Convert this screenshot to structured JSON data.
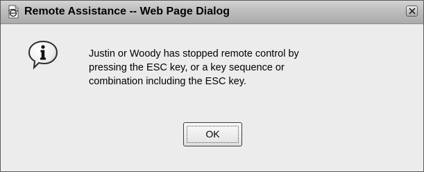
{
  "window": {
    "title": "Remote Assistance -- Web Page Dialog",
    "title_icon": "ie-page-icon",
    "close_icon": "close-icon"
  },
  "message": {
    "icon": "info-icon",
    "lines": [
      "Justin or Woody has stopped remote control by",
      "pressing the ESC key, or a key sequence or",
      "combination including the ESC key."
    ]
  },
  "buttons": {
    "ok_label": "OK"
  }
}
